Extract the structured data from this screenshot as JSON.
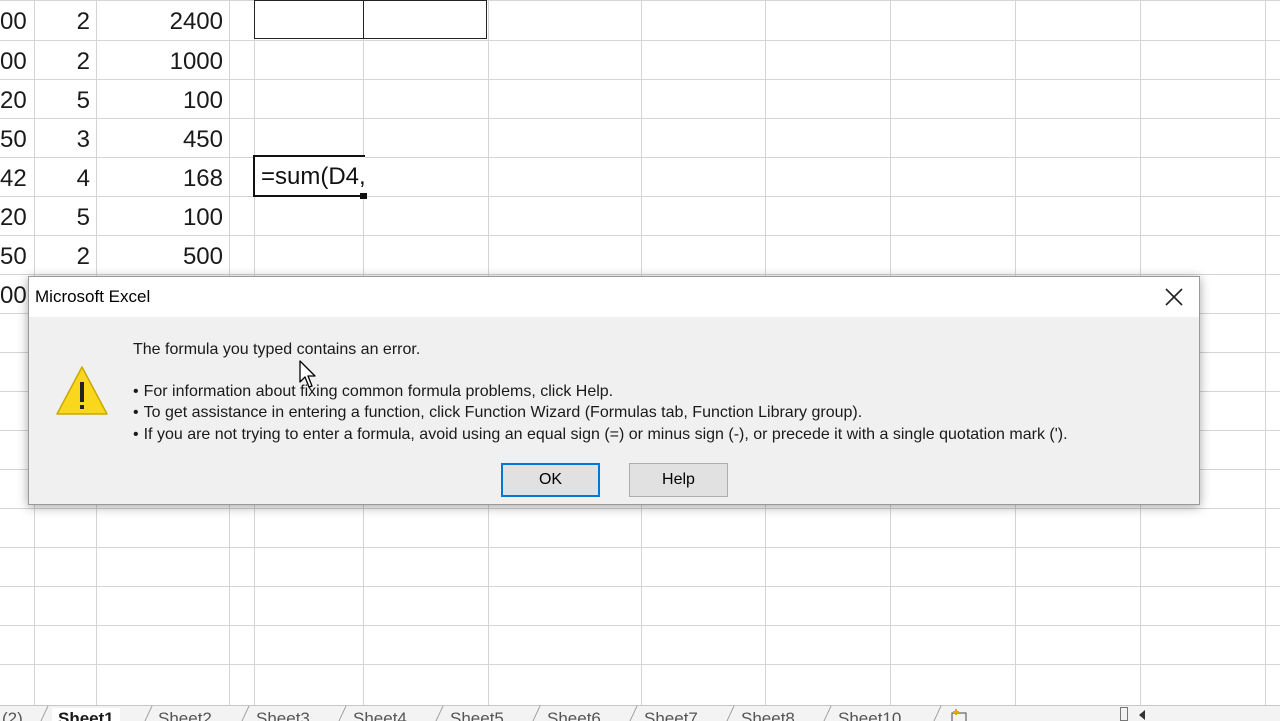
{
  "grid_rows": [
    {
      "a": "00",
      "b": "2",
      "c": "2400"
    },
    {
      "a": "00",
      "b": "2",
      "c": "1000"
    },
    {
      "a": "20",
      "b": "5",
      "c": "100"
    },
    {
      "a": "50",
      "b": "3",
      "c": "450"
    },
    {
      "a": "42",
      "b": "4",
      "c": "168"
    },
    {
      "a": "20",
      "b": "5",
      "c": "100"
    },
    {
      "a": "50",
      "b": "2",
      "c": "500"
    },
    {
      "a": "00",
      "b": "",
      "c": ""
    }
  ],
  "edit_cell": {
    "text": "=sum(D4,"
  },
  "dialog": {
    "title": "Microsoft Excel",
    "message": "The formula you typed contains an error.",
    "bullets": [
      "For information about fixing common formula problems, click Help.",
      "To get assistance in entering a function, click Function Wizard (Formulas tab, Function Library group).",
      "If you are not trying to enter a formula, avoid using an equal sign (=) or minus sign (-), or precede it with a single quotation mark (')."
    ],
    "ok_label": "OK",
    "help_label": "Help",
    "warning_icon": "warning-icon",
    "close_icon": "close-icon"
  },
  "sheet_tabs": [
    "(2)",
    "Sheet1",
    "Sheet2",
    "Sheet3",
    "Sheet4",
    "Sheet5",
    "Sheet6",
    "Sheet7",
    "Sheet8",
    "Sheet10"
  ],
  "active_tab": "Sheet1",
  "colors": {
    "accent": "#0078d7",
    "warning": "#f9d71c",
    "grid": "#d4d4d4"
  }
}
